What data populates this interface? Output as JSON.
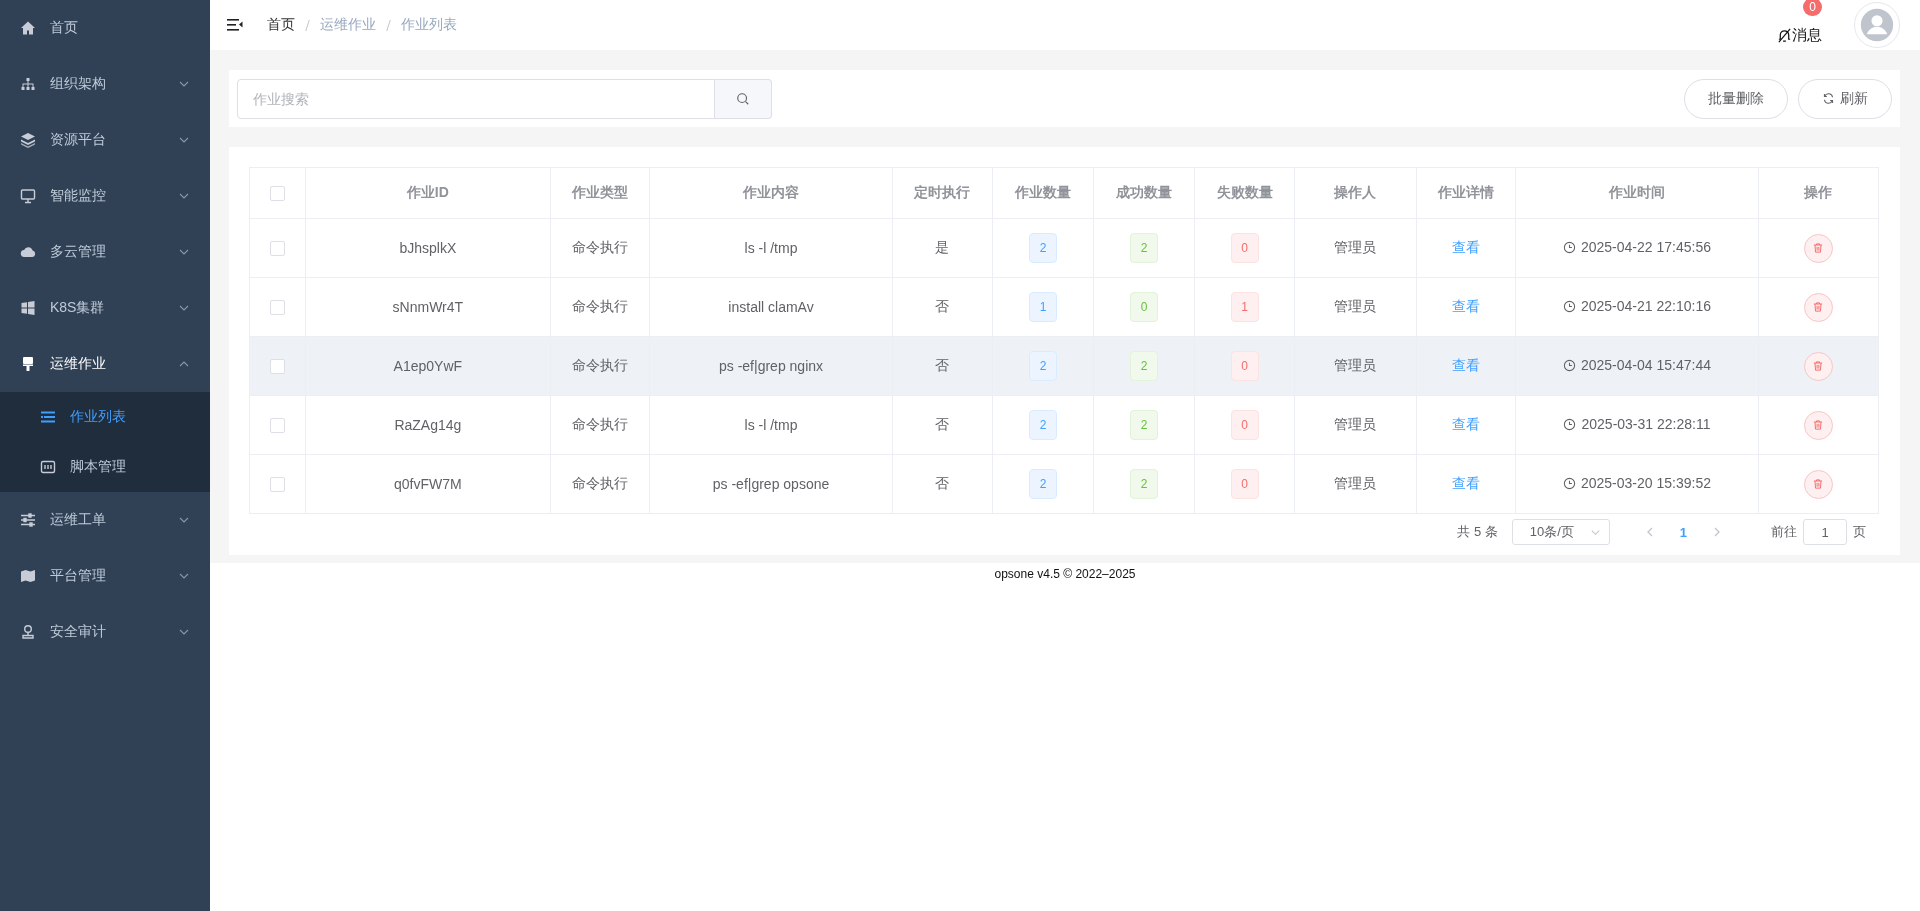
{
  "sidebar": {
    "items": [
      {
        "label": "首页"
      },
      {
        "label": "组织架构",
        "expanded": false
      },
      {
        "label": "资源平台",
        "expanded": false
      },
      {
        "label": "智能监控",
        "expanded": false
      },
      {
        "label": "多云管理",
        "expanded": false
      },
      {
        "label": "K8S集群",
        "expanded": false
      },
      {
        "label": "运维作业",
        "expanded": true,
        "children": [
          {
            "label": "作业列表",
            "selected": true
          },
          {
            "label": "脚本管理",
            "selected": false
          }
        ]
      },
      {
        "label": "运维工单",
        "expanded": false
      },
      {
        "label": "平台管理",
        "expanded": false
      },
      {
        "label": "安全审计",
        "expanded": false
      }
    ]
  },
  "header": {
    "breadcrumb": [
      "首页",
      "运维作业",
      "作业列表"
    ],
    "messages": {
      "label": "消息",
      "count": "0"
    }
  },
  "toolbar": {
    "search": {
      "placeholder": "作业搜索"
    },
    "buttons": [
      {
        "label": "批量删除",
        "kind": "plain"
      },
      {
        "label": "刷新",
        "kind": "refresh"
      }
    ]
  },
  "table": {
    "select_all_checked": false,
    "columns": [
      "作业ID",
      "作业类型",
      "作业内容",
      "定时执行",
      "作业数量",
      "成功数量",
      "失败数量",
      "操作人",
      "作业详情",
      "作业时间",
      "操作"
    ],
    "rows": [
      {
        "checked": false,
        "hovered": false,
        "id": "bJhsplkX",
        "type": "命令执行",
        "content": "ls -l /tmp",
        "timed": "是",
        "total": "2",
        "success": "2",
        "failed": "0",
        "operator": "管理员",
        "detail": "查看",
        "time": "2025-04-22 17:45:56"
      },
      {
        "checked": false,
        "hovered": false,
        "id": "sNnmWr4T",
        "type": "命令执行",
        "content": "install clamAv",
        "timed": "否",
        "total": "1",
        "success": "0",
        "failed": "1",
        "operator": "管理员",
        "detail": "查看",
        "time": "2025-04-21 22:10:16"
      },
      {
        "checked": false,
        "hovered": true,
        "id": "A1ep0YwF",
        "type": "命令执行",
        "content": "ps -ef|grep nginx",
        "timed": "否",
        "total": "2",
        "success": "2",
        "failed": "0",
        "operator": "管理员",
        "detail": "查看",
        "time": "2025-04-04 15:47:44"
      },
      {
        "checked": false,
        "hovered": false,
        "id": "RaZAg14g",
        "type": "命令执行",
        "content": "ls -l /tmp",
        "timed": "否",
        "total": "2",
        "success": "2",
        "failed": "0",
        "operator": "管理员",
        "detail": "查看",
        "time": "2025-03-31 22:28:11"
      },
      {
        "checked": false,
        "hovered": false,
        "id": "q0fvFW7M",
        "type": "命令执行",
        "content": "ps -ef|grep opsone",
        "timed": "否",
        "total": "2",
        "success": "2",
        "failed": "0",
        "operator": "管理员",
        "detail": "查看",
        "time": "2025-03-20 15:39:52"
      }
    ]
  },
  "pagination": {
    "total": "共 5 条",
    "page_size": "10条/页",
    "pages": [
      {
        "label": "1",
        "selected": true
      }
    ],
    "goto_label": "前往",
    "goto_value": "1",
    "goto_suffix": "页"
  },
  "footer": "opsone v4.5 © 2022–2025"
}
